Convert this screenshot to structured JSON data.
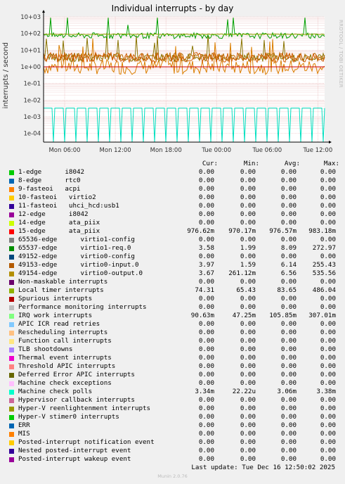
{
  "title": "Individual interrupts - by day",
  "side_label": "RRDTOOL / TOBI OETIKER",
  "chart_data": {
    "type": "line",
    "ylabel": "interrupts / second",
    "yscale": "log",
    "ylim": [
      3e-05,
      1000
    ],
    "ytick_labels": [
      "10+03",
      "10+02",
      "10+01",
      "1e+00",
      "1e-01",
      "1e-02",
      "1e-03",
      "1e-04"
    ],
    "yticks": [
      1000,
      100,
      10,
      1,
      0.1,
      0.01,
      0.001,
      0.0001
    ],
    "xtick_labels": [
      "Mon 06:00",
      "Mon 12:00",
      "Mon 18:00",
      "Tue 00:00",
      "Tue 06:00",
      "Tue 12:00"
    ],
    "x_hours": [
      6,
      12,
      18,
      24,
      30,
      36
    ],
    "x_range_hours": [
      3.5,
      36.8
    ],
    "hrule_value": 1,
    "series": [
      {
        "name": "15-edge ata_piix",
        "color": "#DB7E00",
        "level": 0.98,
        "noise": 0.9,
        "spikes": true
      },
      {
        "name": "65537-edge virtio1-req.0",
        "color": "#8A7400",
        "level": 3.6,
        "noise": 0.5,
        "spikes": true
      },
      {
        "name": "49153-edge virtio0-input.0",
        "color": "#B86A00",
        "level": 4.0,
        "noise": 0.5,
        "spikes": false
      },
      {
        "name": "49154-edge virtio0-output.0",
        "color": "#D05A00",
        "level": 3.7,
        "noise": 0.6,
        "spikes": false
      },
      {
        "name": "Local timer interrupts",
        "color": "#00A000",
        "level": 74,
        "noise": 0.35,
        "spikes": true
      },
      {
        "name": "IRQ work interrupts",
        "color": "#8BAA00",
        "level": 90,
        "noise": 0.05,
        "spikes": false
      },
      {
        "name": "Machine check polls",
        "color": "#00E0C0",
        "level": 0.00334,
        "noise": 0,
        "spikes": false,
        "pulse": true
      }
    ],
    "columns": [
      "Cur:",
      "Min:",
      "Avg:",
      "Max:"
    ],
    "rows": [
      {
        "label": "1-edge      i8042",
        "color": "#00CC00",
        "cur": "0.00",
        "min": "0.00",
        "avg": "0.00",
        "max": "0.00"
      },
      {
        "label": "8-edge      rtc0",
        "color": "#0066B3",
        "cur": "0.00",
        "min": "0.00",
        "avg": "0.00",
        "max": "0.00"
      },
      {
        "label": "9-fasteoi   acpi",
        "color": "#FF8000",
        "cur": "0.00",
        "min": "0.00",
        "avg": "0.00",
        "max": "0.00"
      },
      {
        "label": "10-fasteoi   virtio2",
        "color": "#FFCC00",
        "cur": "0.00",
        "min": "0.00",
        "avg": "0.00",
        "max": "0.00"
      },
      {
        "label": "11-fasteoi   uhci_hcd:usb1",
        "color": "#330099",
        "cur": "0.00",
        "min": "0.00",
        "avg": "0.00",
        "max": "0.00"
      },
      {
        "label": "12-edge      i8042",
        "color": "#990099",
        "cur": "0.00",
        "min": "0.00",
        "avg": "0.00",
        "max": "0.00"
      },
      {
        "label": "14-edge      ata_piix",
        "color": "#CCFF00",
        "cur": "0.00",
        "min": "0.00",
        "avg": "0.00",
        "max": "0.00"
      },
      {
        "label": "15-edge      ata_piix",
        "color": "#FF0000",
        "cur": "976.62m",
        "min": "970.17m",
        "avg": "976.57m",
        "max": "983.18m"
      },
      {
        "label": "65536-edge      virtio1-config",
        "color": "#808080",
        "cur": "0.00",
        "min": "0.00",
        "avg": "0.00",
        "max": "0.00"
      },
      {
        "label": "65537-edge      virtio1-req.0",
        "color": "#008F00",
        "cur": "3.58",
        "min": "1.99",
        "avg": "8.09",
        "max": "272.97"
      },
      {
        "label": "49152-edge      virtio0-config",
        "color": "#00487D",
        "cur": "0.00",
        "min": "0.00",
        "avg": "0.00",
        "max": "0.00"
      },
      {
        "label": "49153-edge      virtio0-input.0",
        "color": "#B35A00",
        "cur": "3.97",
        "min": "1.59",
        "avg": "6.14",
        "max": "255.43"
      },
      {
        "label": "49154-edge      virtio0-output.0",
        "color": "#B38F00",
        "cur": "3.67",
        "min": "261.12m",
        "avg": "6.56",
        "max": "535.56"
      },
      {
        "label": "Non-maskable interrupts",
        "color": "#6B006B",
        "cur": "0.00",
        "min": "0.00",
        "avg": "0.00",
        "max": "0.00"
      },
      {
        "label": "Local timer interrupts",
        "color": "#8FB300",
        "cur": "74.31",
        "min": "65.43",
        "avg": "83.65",
        "max": "486.04"
      },
      {
        "label": "Spurious interrupts",
        "color": "#B30000",
        "cur": "0.00",
        "min": "0.00",
        "avg": "0.00",
        "max": "0.00"
      },
      {
        "label": "Performance monitoring interrupts",
        "color": "#BEBEBE",
        "cur": "0.00",
        "min": "0.00",
        "avg": "0.00",
        "max": "0.00"
      },
      {
        "label": "IRQ work interrupts",
        "color": "#80FF80",
        "cur": "90.63m",
        "min": "47.25m",
        "avg": "105.85m",
        "max": "307.01m"
      },
      {
        "label": "APIC ICR read retries",
        "color": "#80C9FF",
        "cur": "0.00",
        "min": "0.00",
        "avg": "0.00",
        "max": "0.00"
      },
      {
        "label": "Rescheduling interrupts",
        "color": "#FFC080",
        "cur": "0.00",
        "min": "0.00",
        "avg": "0.00",
        "max": "0.00"
      },
      {
        "label": "Function call interrupts",
        "color": "#FFE680",
        "cur": "0.00",
        "min": "0.00",
        "avg": "0.00",
        "max": "0.00"
      },
      {
        "label": "TLB shootdowns",
        "color": "#AA80FF",
        "cur": "0.00",
        "min": "0.00",
        "avg": "0.00",
        "max": "0.00"
      },
      {
        "label": "Thermal event interrupts",
        "color": "#EE00CC",
        "cur": "0.00",
        "min": "0.00",
        "avg": "0.00",
        "max": "0.00"
      },
      {
        "label": "Threshold APIC interrupts",
        "color": "#FF8080",
        "cur": "0.00",
        "min": "0.00",
        "avg": "0.00",
        "max": "0.00"
      },
      {
        "label": "Deferred Error APIC interrupts",
        "color": "#666600",
        "cur": "0.00",
        "min": "0.00",
        "avg": "0.00",
        "max": "0.00"
      },
      {
        "label": "Machine check exceptions",
        "color": "#FFBFFF",
        "cur": "0.00",
        "min": "0.00",
        "avg": "0.00",
        "max": "0.00"
      },
      {
        "label": "Machine check polls",
        "color": "#00FFCC",
        "cur": "3.34m",
        "min": "22.22u",
        "avg": "3.06m",
        "max": "3.38m"
      },
      {
        "label": "Hypervisor callback interrupts",
        "color": "#CC6699",
        "cur": "0.00",
        "min": "0.00",
        "avg": "0.00",
        "max": "0.00"
      },
      {
        "label": "Hyper-V reenlightenment interrupts",
        "color": "#999900",
        "cur": "0.00",
        "min": "0.00",
        "avg": "0.00",
        "max": "0.00"
      },
      {
        "label": "Hyper-V stimer0 interrupts",
        "color": "#00CC00",
        "cur": "0.00",
        "min": "0.00",
        "avg": "0.00",
        "max": "0.00"
      },
      {
        "label": "ERR",
        "color": "#0066B3",
        "cur": "0.00",
        "min": "0.00",
        "avg": "0.00",
        "max": "0.00"
      },
      {
        "label": "MIS",
        "color": "#FF8000",
        "cur": "0.00",
        "min": "0.00",
        "avg": "0.00",
        "max": "0.00"
      },
      {
        "label": "Posted-interrupt notification event",
        "color": "#FFCC00",
        "cur": "0.00",
        "min": "0.00",
        "avg": "0.00",
        "max": "0.00"
      },
      {
        "label": "Nested posted-interrupt event",
        "color": "#330099",
        "cur": "0.00",
        "min": "0.00",
        "avg": "0.00",
        "max": "0.00"
      },
      {
        "label": "Posted-interrupt wakeup event",
        "color": "#990099",
        "cur": "0.00",
        "min": "0.00",
        "avg": "0.00",
        "max": "0.00"
      }
    ]
  },
  "last_update": "Last update: Tue Dec 16 12:50:02 2025",
  "version": "Munin 2.0.76"
}
